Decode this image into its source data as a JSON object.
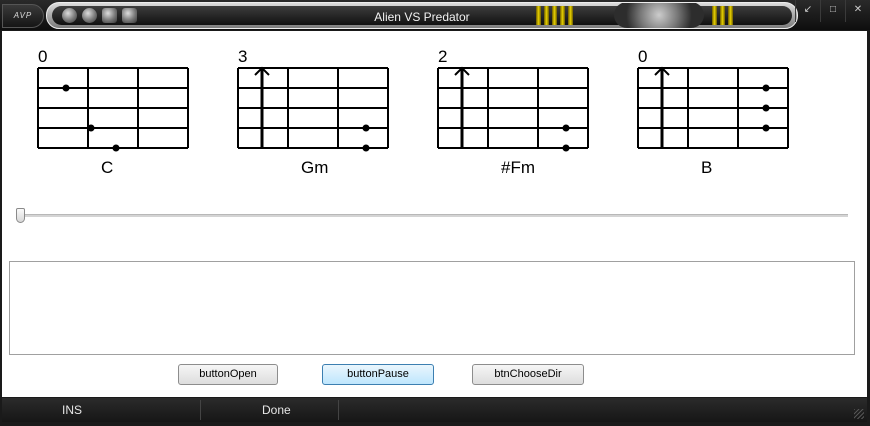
{
  "window": {
    "logo": "AVP",
    "title": "Alien VS Predator",
    "icons": [
      "alien-head-icon",
      "lamp-icon",
      "bucket-icon",
      "predator-figure-icon"
    ],
    "controls": [
      "restore-icon",
      "maximize-icon",
      "close-icon"
    ]
  },
  "chords": [
    {
      "name": "C",
      "fret": "0",
      "barre_string": null,
      "dots": [
        [
          1,
          1
        ],
        [
          2,
          3
        ],
        [
          3,
          4
        ]
      ]
    },
    {
      "name": "Gm",
      "fret": "3",
      "barre_string": 0,
      "dots": [
        [
          5,
          3
        ],
        [
          5,
          4
        ]
      ]
    },
    {
      "name": "#Fm",
      "fret": "2",
      "barre_string": 0,
      "dots": [
        [
          5,
          3
        ],
        [
          5,
          4
        ]
      ]
    },
    {
      "name": "B",
      "fret": "0",
      "barre_string": 0,
      "dots": [
        [
          5,
          1
        ],
        [
          5,
          2
        ],
        [
          5,
          3
        ]
      ]
    }
  ],
  "playback": {
    "position": 0
  },
  "text_output": {
    "value": ""
  },
  "buttons": {
    "open": "buttonOpen",
    "pause": "buttonPause",
    "choose_dir": "btnChooseDir"
  },
  "status": {
    "mode": "INS",
    "message": "Done"
  },
  "colors": {
    "chrome_dark": "#161616",
    "client_bg": "#ffffff",
    "focus_button": "#bee6fd",
    "art_yellow": "#e8d200"
  }
}
